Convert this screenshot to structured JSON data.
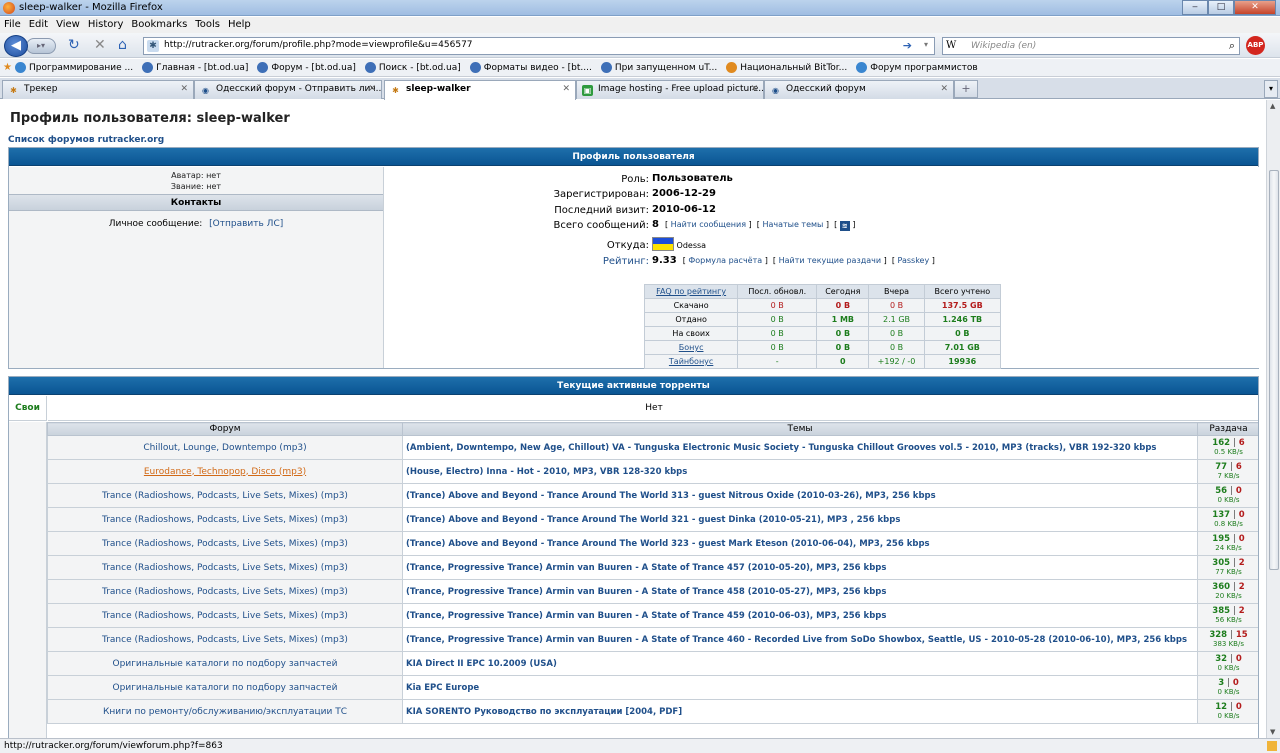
{
  "window": {
    "title": "sleep-walker - Mozilla Firefox",
    "minimize": "‒",
    "maximize": "□",
    "close": "✕"
  },
  "menu": [
    "File",
    "Edit",
    "View",
    "History",
    "Bookmarks",
    "Tools",
    "Help"
  ],
  "nav": {
    "url": "http://rutracker.org/forum/profile.php?mode=viewprofile&u=456577",
    "search_placeholder": "Wikipedia (en)",
    "search_engine": "W"
  },
  "bookmarks": [
    "Программирование ...",
    "Главная - [bt.od.ua]",
    "Форум - [bt.od.ua]",
    "Поиск - [bt.od.ua]",
    "Форматы видео - [bt....",
    "При запущенном uT...",
    "Национальный BitTor...",
    "Форум программистов"
  ],
  "tabs": [
    {
      "label": "Трекер"
    },
    {
      "label": "Одесский форум - Отправить лич..."
    },
    {
      "label": "sleep-walker"
    },
    {
      "label": "Image hosting - Free upload picture..."
    },
    {
      "label": "Одесский форум"
    }
  ],
  "page": {
    "title": "Профиль пользователя: sleep-walker",
    "breadcrumb": "Список форумов rutracker.org",
    "profile_header": "Профиль пользователя",
    "avatar_line": "Аватар: нет",
    "rank_line": "Звание: нет",
    "contacts_header": "Контакты",
    "pm_label": "Личное сообщение:",
    "pm_link": "[Отправить ЛС]",
    "role_label": "Роль:",
    "role_value": "Пользователь",
    "reg_label": "Зарегистрирован:",
    "reg_value": "2006-12-29",
    "last_label": "Последний визит:",
    "last_value": "2010-06-12",
    "posts_label": "Всего сообщений:",
    "posts_value": "8",
    "find_posts": "Найти сообщения",
    "started_topics": "Начатые темы",
    "from_label": "Откуда:",
    "from_value": "Odessa",
    "rating_label": "Рейтинг:",
    "rating_value": "9.33",
    "formula": "Формула расчёта",
    "find_current": "Найти текущие раздачи",
    "passkey": "Passkey",
    "active_header": "Текущие активные торренты",
    "svoi": "Свои",
    "net": "Нет",
    "col_forum": "Форум",
    "col_topics": "Темы",
    "col_seed": "Раздача"
  },
  "stats": {
    "headers": [
      "FAQ по рейтингу",
      "Посл. обновл.",
      "Сегодня",
      "Вчера",
      "Всего учтено"
    ],
    "rows": [
      {
        "label": "Скачано",
        "last": "0 B",
        "today": "0 B",
        "yesterday": "0 B",
        "total": "137.5 GB"
      },
      {
        "label": "Отдано",
        "last": "0 B",
        "today": "1 MB",
        "yesterday": "2.1 GB",
        "total": "1.246 TB"
      },
      {
        "label": "На своих",
        "last": "0 B",
        "today": "0 B",
        "yesterday": "0 B",
        "total": "0 B"
      },
      {
        "label": "Бонус",
        "last": "0 B",
        "today": "0 B",
        "yesterday": "0 B",
        "total": "7.01 GB"
      },
      {
        "label": "Тайнбонус",
        "last": "-",
        "today": "0",
        "yesterday": "+192 / -0",
        "total": "19936"
      }
    ]
  },
  "torrents": [
    {
      "forum": "Chillout, Lounge, Downtempo (mp3)",
      "topic": "(Ambient, Downtempo, New Age, Chillout) VA - Tunguska Electronic Music Society - Tunguska Chillout Grooves vol.5 - 2010, MP3 (tracks), VBR 192-320 kbps",
      "seeds": "162",
      "leech": "6",
      "speed": "0.5 KB/s"
    },
    {
      "forum": "Eurodance, Technopop, Disco (mp3)",
      "topic": "(House, Electro) Inna - Hot - 2010, MP3, VBR 128-320 kbps",
      "seeds": "77",
      "leech": "6",
      "speed": "7 KB/s"
    },
    {
      "forum": "Trance (Radioshows, Podcasts, Live Sets, Mixes) (mp3)",
      "topic": "(Trance) Above and Beyond - Trance Around The World 313 - guest Nitrous Oxide (2010-03-26), MP3, 256 kbps",
      "seeds": "56",
      "leech": "0",
      "speed": "0 KB/s"
    },
    {
      "forum": "Trance (Radioshows, Podcasts, Live Sets, Mixes) (mp3)",
      "topic": "(Trance) Above and Beyond - Trance Around The World 321 - guest Dinka (2010-05-21), MP3 , 256 kbps",
      "seeds": "137",
      "leech": "0",
      "speed": "0.8 KB/s"
    },
    {
      "forum": "Trance (Radioshows, Podcasts, Live Sets, Mixes) (mp3)",
      "topic": "(Trance) Above and Beyond - Trance Around The World 323 - guest Mark Eteson (2010-06-04), MP3, 256 kbps",
      "seeds": "195",
      "leech": "0",
      "speed": "24 KB/s"
    },
    {
      "forum": "Trance (Radioshows, Podcasts, Live Sets, Mixes) (mp3)",
      "topic": "(Trance, Progressive Trance) Armin van Buuren - A State of Trance 457 (2010-05-20), MP3, 256 kbps",
      "seeds": "305",
      "leech": "2",
      "speed": "77 KB/s"
    },
    {
      "forum": "Trance (Radioshows, Podcasts, Live Sets, Mixes) (mp3)",
      "topic": "(Trance, Progressive Trance) Armin van Buuren - A State of Trance 458 (2010-05-27), MP3, 256 kbps",
      "seeds": "360",
      "leech": "2",
      "speed": "20 KB/s"
    },
    {
      "forum": "Trance (Radioshows, Podcasts, Live Sets, Mixes) (mp3)",
      "topic": "(Trance, Progressive Trance) Armin van Buuren - A State of Trance 459 (2010-06-03), MP3, 256 kbps",
      "seeds": "385",
      "leech": "2",
      "speed": "56 KB/s"
    },
    {
      "forum": "Trance (Radioshows, Podcasts, Live Sets, Mixes) (mp3)",
      "topic": "(Trance, Progressive Trance) Armin van Buuren - A State of Trance 460 - Recorded Live from SoDo Showbox, Seattle, US - 2010-05-28 (2010-06-10), MP3, 256 kbps",
      "seeds": "328",
      "leech": "15",
      "speed": "383 KB/s"
    },
    {
      "forum": "Оригинальные каталоги по подбору запчастей",
      "topic": "KIA Direct II EPC 10.2009 (USA)",
      "seeds": "32",
      "leech": "0",
      "speed": "0 KB/s"
    },
    {
      "forum": "Оригинальные каталоги по подбору запчастей",
      "topic": "Kia EPC Europe",
      "seeds": "3",
      "leech": "0",
      "speed": "0 KB/s"
    },
    {
      "forum": "Книги по ремонту/обслуживанию/эксплуатации ТС",
      "topic": "KIA SORENTO Руководство по эксплуатации [2004, PDF]",
      "seeds": "12",
      "leech": "0",
      "speed": "0 KB/s"
    }
  ],
  "status": "http://rutracker.org/forum/viewforum.php?f=863"
}
